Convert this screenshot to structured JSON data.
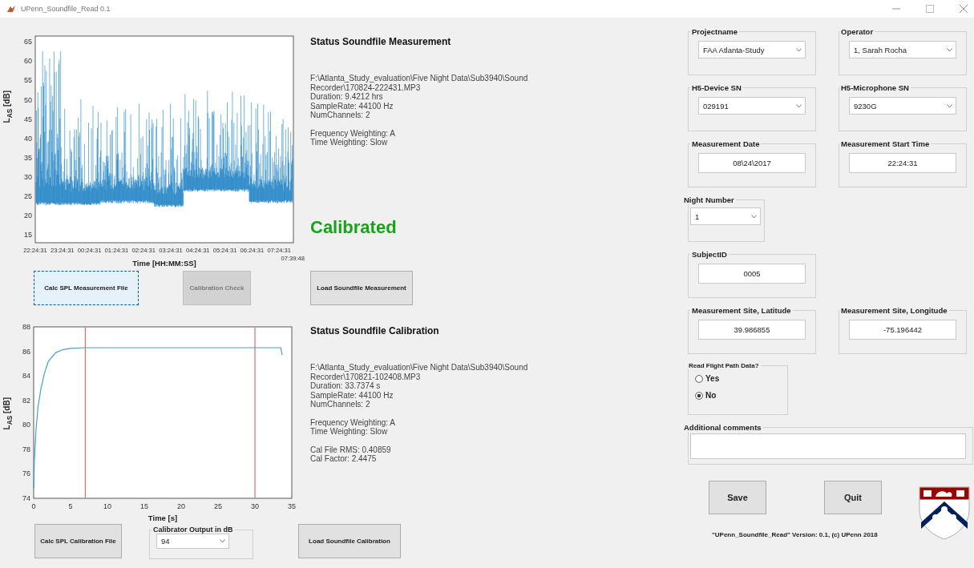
{
  "window": {
    "title": "UPenn_Soundfile_Read 0.1"
  },
  "measurement": {
    "plot": {
      "ylabel": "L$_{AS}$ [dB]",
      "xlabel": "Time [HH:MM:SS]",
      "yticks": [
        "65",
        "60",
        "55",
        "50",
        "45",
        "40",
        "35",
        "30",
        "25",
        "20",
        "15"
      ],
      "xticks": [
        "22:24:31",
        "23:24:31",
        "00:24:31",
        "01:24:31",
        "02:24:31",
        "03:24:31",
        "04:24:31",
        "05:24:31",
        "06:24:31",
        "07:24:31"
      ],
      "end_tick": "07:39:48"
    },
    "status_title": "Status Soundfile Measurement",
    "info_groups": [
      [
        "F:\\Atlanta_Study_evaluation\\Five Night Data\\Sub3940\\Sound Recorder\\170824-222431.MP3",
        "Duration: 9.4212 hrs",
        "SampleRate: 44100 Hz",
        "NumChannels: 2"
      ],
      [
        "Frequency Weighting: A",
        "Time Weighting: Slow"
      ]
    ],
    "status": "Calibrated",
    "buttons": [
      {
        "label": "Calc SPL Measurement File",
        "disabled": false,
        "focused": true
      },
      {
        "label": "Calibration Check",
        "disabled": true,
        "focused": false
      },
      {
        "label": "Load Soundfile Measurement",
        "disabled": false,
        "focused": false
      }
    ]
  },
  "calibration": {
    "chart_data": {
      "type": "line",
      "xlabel": "Time [s]",
      "ylabel": "L$_{AS}$ [dB]",
      "x": [
        0,
        0.1,
        0.3,
        0.6,
        1,
        1.5,
        2,
        3,
        4,
        5,
        7,
        33.5,
        33.7
      ],
      "values": [
        74.8,
        77,
        79.5,
        81.5,
        83,
        84.3,
        85.2,
        85.9,
        86.15,
        86.25,
        86.3,
        86.3,
        85.7
      ],
      "xlim": [
        0,
        35
      ],
      "ylim": [
        74,
        88
      ],
      "xticks": [
        0,
        5,
        10,
        15,
        20,
        25,
        30,
        35
      ],
      "yticks": [
        74,
        76,
        78,
        80,
        82,
        84,
        86,
        88
      ],
      "ref_lines": [
        {
          "axis": "x",
          "value": 7
        },
        {
          "axis": "x",
          "value": 30
        }
      ]
    },
    "status_title": "Status Soundfile Calibration",
    "info_groups": [
      [
        "F:\\Atlanta_Study_evaluation\\Five Night Data\\Sub3940\\Sound Recorder\\170821-102408.MP3",
        "Duration: 33.7374 s",
        "SampleRate: 44100 Hz",
        "NumChannels: 2"
      ],
      [
        "Frequency Weighting: A",
        "Time Weighting: Slow"
      ],
      [
        "Cal File RMS: 0.40859",
        "Cal Factor: 2.4475"
      ]
    ],
    "calc_button": {
      "label": "Calc SPL Calibration File"
    },
    "calibrator_output": {
      "label": "Calibrator Output in dB",
      "value": "94"
    },
    "load_button": {
      "label": "Load Soundfile Calibration"
    }
  },
  "form": {
    "rows": [
      [
        {
          "label": "Projectname",
          "kind": "dropdown",
          "value": "FAA Atlanta-Study"
        },
        {
          "label": "Operator",
          "kind": "dropdown",
          "value": "1, Sarah Rocha"
        }
      ],
      [
        {
          "label": "H5-Device SN",
          "kind": "dropdown",
          "value": "029191"
        },
        {
          "label": "H5-Microphone SN",
          "kind": "dropdown",
          "value": "9230G"
        }
      ],
      [
        {
          "label": "Measurement Date",
          "kind": "text",
          "value": "08\\24\\2017"
        },
        {
          "label": "Measurement Start Time",
          "kind": "text",
          "value": "22:24:31"
        }
      ],
      [
        {
          "label": "Night Number",
          "kind": "dropdown",
          "value": "1"
        }
      ],
      [
        {
          "label": "SubjectID",
          "kind": "text",
          "value": "0005"
        }
      ],
      [
        {
          "label": "Measurement Site, Latitude",
          "kind": "text",
          "value": "39.986855"
        },
        {
          "label": "Measurement Site, Longitude",
          "kind": "text",
          "value": "-75.196442"
        }
      ]
    ],
    "flight_path": {
      "label": "Read Flight Path Data?",
      "options": [
        {
          "label": "Yes",
          "selected": false
        },
        {
          "label": "No",
          "selected": true
        }
      ]
    },
    "comments": {
      "label": "Additional comments"
    },
    "buttons": [
      "Save",
      "Quit"
    ],
    "footer": "\"UPenn_Soundfile_Read\" Version: 0.1, (c) UPenn 2018"
  }
}
